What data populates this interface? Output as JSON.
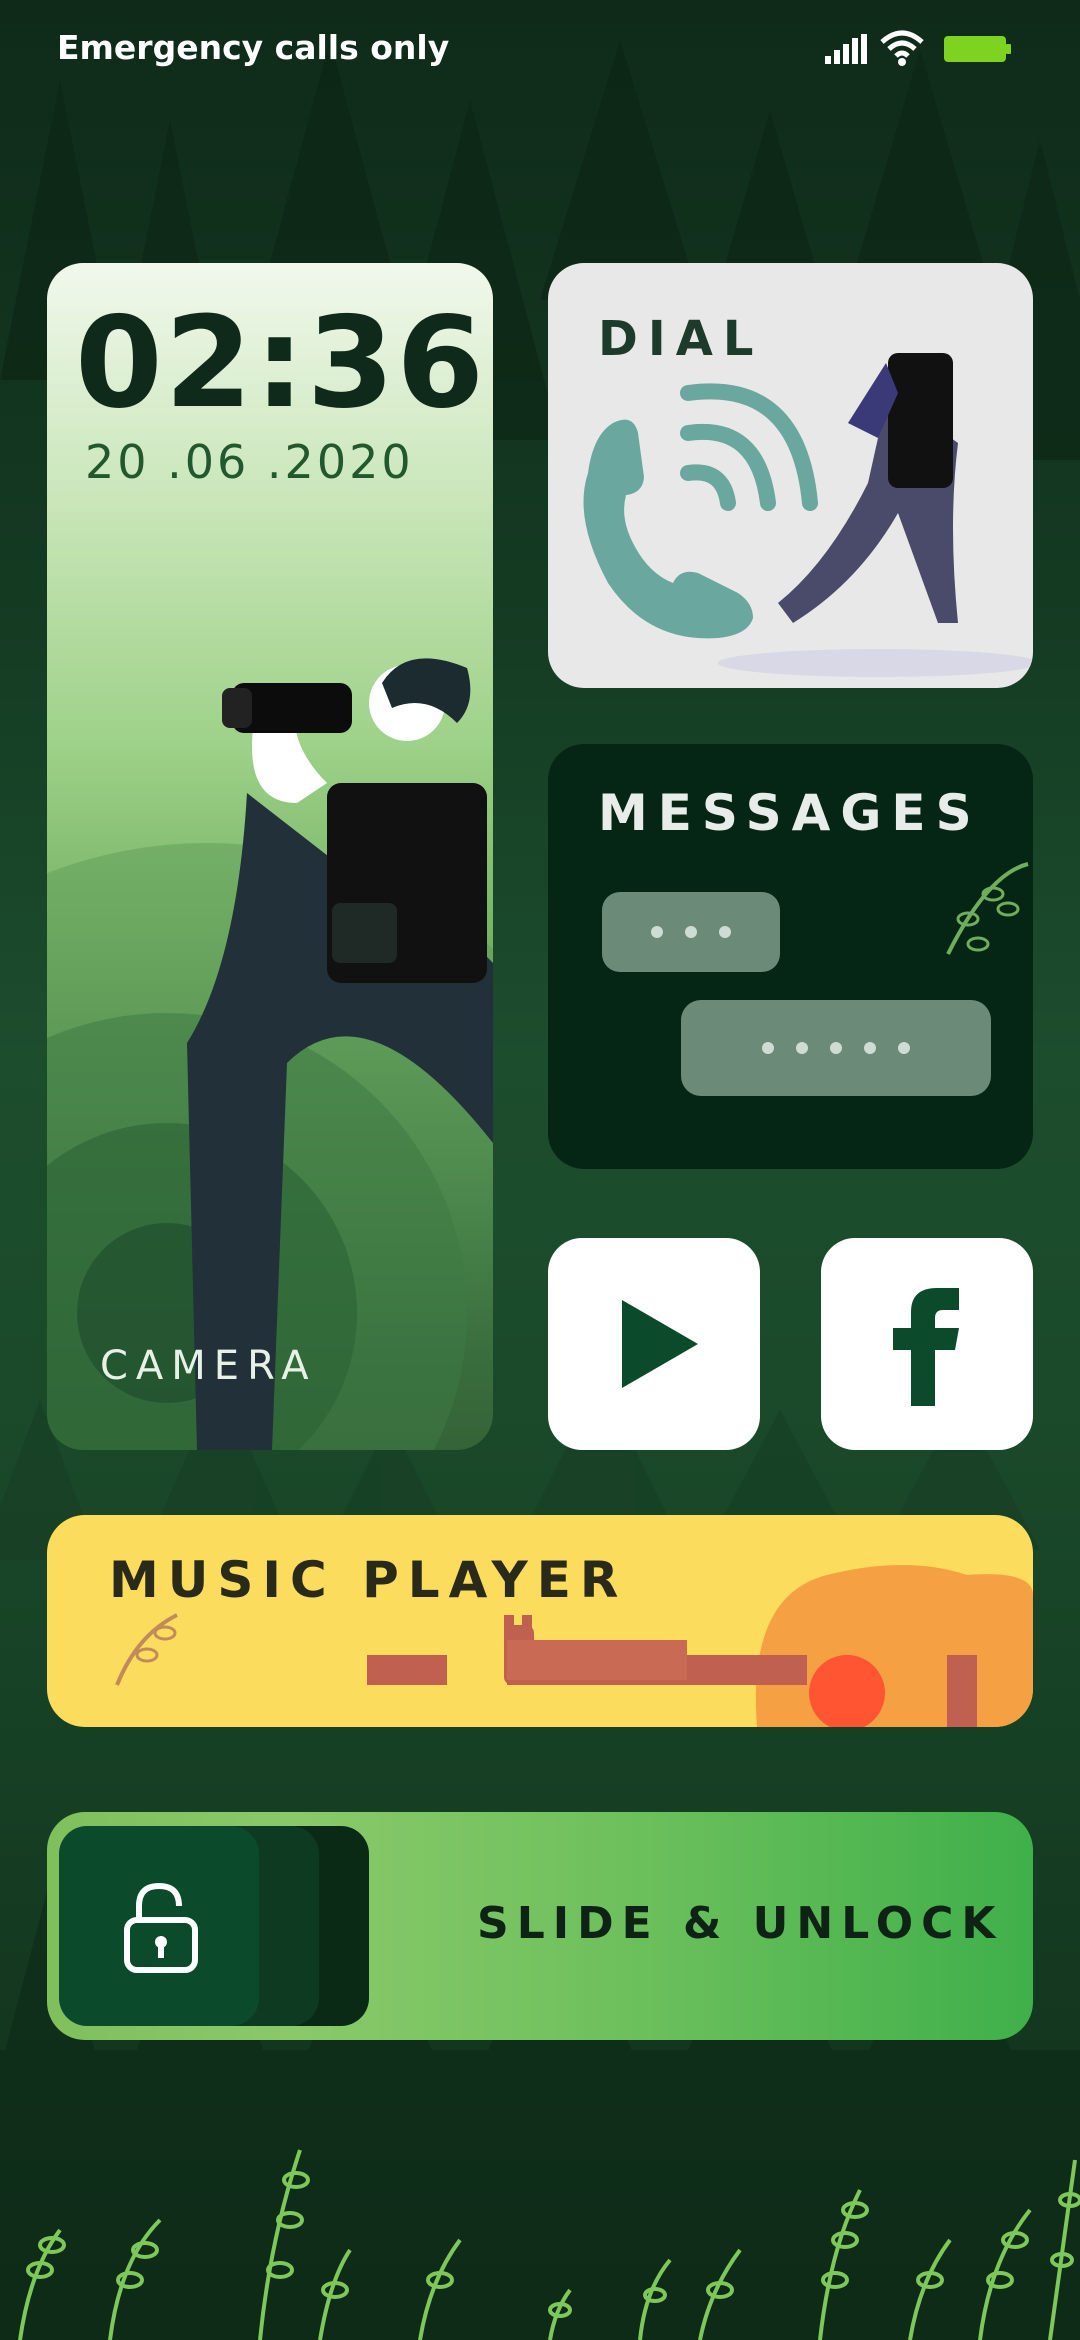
{
  "status_bar": {
    "carrier_text": "Emergency calls only",
    "signal_icon": "signal-icon",
    "wifi_icon": "wifi-icon",
    "battery_icon": "battery-icon",
    "battery_color": "#7ed321"
  },
  "clock_widget": {
    "time": "02:36",
    "date": "20 .06 .2020",
    "label": "CAMERA"
  },
  "dial_widget": {
    "label": "DIAL",
    "icon": "phone-icon",
    "icon_color": "#6aa79e"
  },
  "messages_widget": {
    "label": "MESSAGES",
    "icon": "chat-bubbles-icon"
  },
  "apps": [
    {
      "name": "play",
      "icon": "play-icon",
      "color": "#0b4a2b"
    },
    {
      "name": "facebook",
      "icon": "facebook-icon",
      "color": "#0b4a2b"
    }
  ],
  "music_widget": {
    "label": "MUSIC PLAYER",
    "icon": "guitar-icon",
    "background": "#fcdc5c"
  },
  "unlock": {
    "label": "SLIDE & UNLOCK",
    "icon": "unlock-icon"
  },
  "colors": {
    "accent": "#0b4a2b",
    "dark_card": "#062615"
  }
}
